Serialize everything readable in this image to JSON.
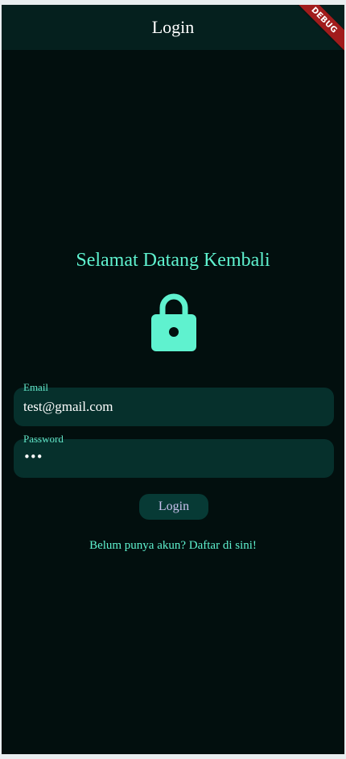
{
  "appbar": {
    "title": "Login"
  },
  "debug_banner": {
    "label": "DEBUG"
  },
  "main": {
    "welcome_text": "Selamat Datang Kembali",
    "lock_icon": "lock-icon"
  },
  "form": {
    "email": {
      "label": "Email",
      "value": "test@gmail.com"
    },
    "password": {
      "label": "Password",
      "value": "•••"
    },
    "login_button_label": "Login",
    "register_link": "Belum punya akun? Daftar di sini!"
  },
  "colors": {
    "background": "#020f0e",
    "appbar": "#05201e",
    "accent": "#5ff2cf",
    "field_fill": "#06302c",
    "button_fill": "#073a35",
    "button_text": "#c9c2ee",
    "debug_banner": "#a11c1c"
  }
}
